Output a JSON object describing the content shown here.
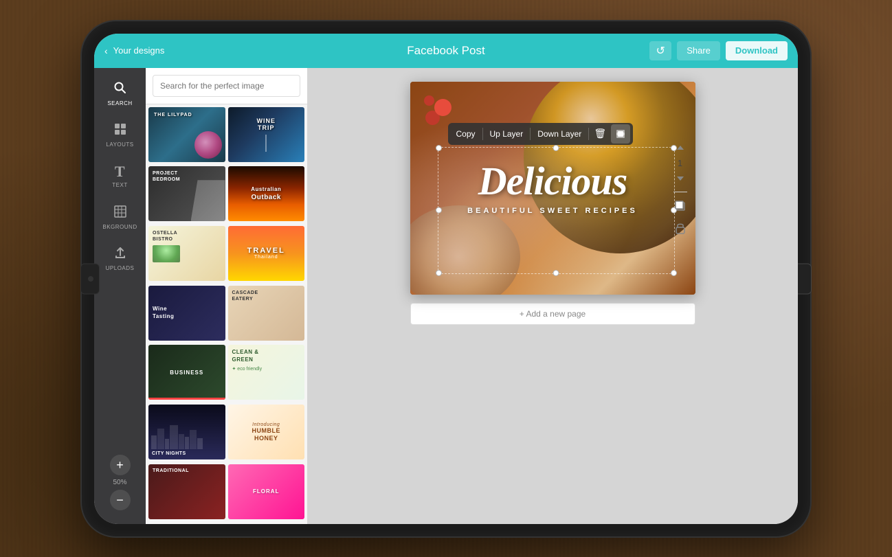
{
  "background": {
    "color": "#5c3d1e"
  },
  "header": {
    "back_label": "Your designs",
    "title": "Facebook Post",
    "undo_label": "↺",
    "share_label": "Share",
    "download_label": "Download"
  },
  "sidebar": {
    "items": [
      {
        "id": "search",
        "label": "SEARCH",
        "icon": "🔍"
      },
      {
        "id": "layouts",
        "label": "LAYOUTS",
        "icon": "⊞"
      },
      {
        "id": "text",
        "label": "TEXT",
        "icon": "T"
      },
      {
        "id": "background",
        "label": "BKGROUND",
        "icon": "▤"
      },
      {
        "id": "uploads",
        "label": "UPLOADS",
        "icon": "↑"
      }
    ],
    "zoom_plus": "+",
    "zoom_level": "50%",
    "zoom_minus": "−"
  },
  "panel": {
    "search_placeholder": "Search for the perfect image",
    "templates": [
      {
        "id": 1,
        "label": "THE LILYPAD",
        "class": "tpl-lily"
      },
      {
        "id": 2,
        "label": "WINE TRIP",
        "class": "tpl-wine-paris"
      },
      {
        "id": 3,
        "label": "PROJECT BEDROOM",
        "class": "tpl-project"
      },
      {
        "id": 4,
        "label": "Australian Outback",
        "class": "tpl-outback"
      },
      {
        "id": 5,
        "label": "OSTELLA BISTRO",
        "class": "tpl-ostella"
      },
      {
        "id": 6,
        "label": "TRAVEL Thailand",
        "class": "tpl-travel"
      },
      {
        "id": 7,
        "label": "Wine Tasting",
        "class": "tpl-wine-tasting"
      },
      {
        "id": 8,
        "label": "CASCADE EATERY",
        "class": "tpl-cascade"
      },
      {
        "id": 9,
        "label": "BUSINESS",
        "class": "tpl-business"
      },
      {
        "id": 10,
        "label": "CLEAN & GREEN",
        "class": "tpl-clean"
      },
      {
        "id": 11,
        "label": "CITY",
        "class": "tpl-city"
      },
      {
        "id": 12,
        "label": "HUMBLE HONEY",
        "class": "tpl-humble"
      },
      {
        "id": 13,
        "label": "TRADITIONAL",
        "class": "tpl-traditional"
      },
      {
        "id": 14,
        "label": "",
        "class": "tpl-pink"
      }
    ]
  },
  "canvas": {
    "design_title": "Delicious",
    "design_subtitle": "BEAUTIFUL SWEET RECIPES",
    "context_menu": {
      "copy": "Copy",
      "up_layer": "Up Layer",
      "down_layer": "Down Layer"
    },
    "add_page_label": "+ Add a new page"
  },
  "right_controls": {
    "up_arrow": "▲",
    "layer_num": "1",
    "down_arrow": "▼"
  }
}
